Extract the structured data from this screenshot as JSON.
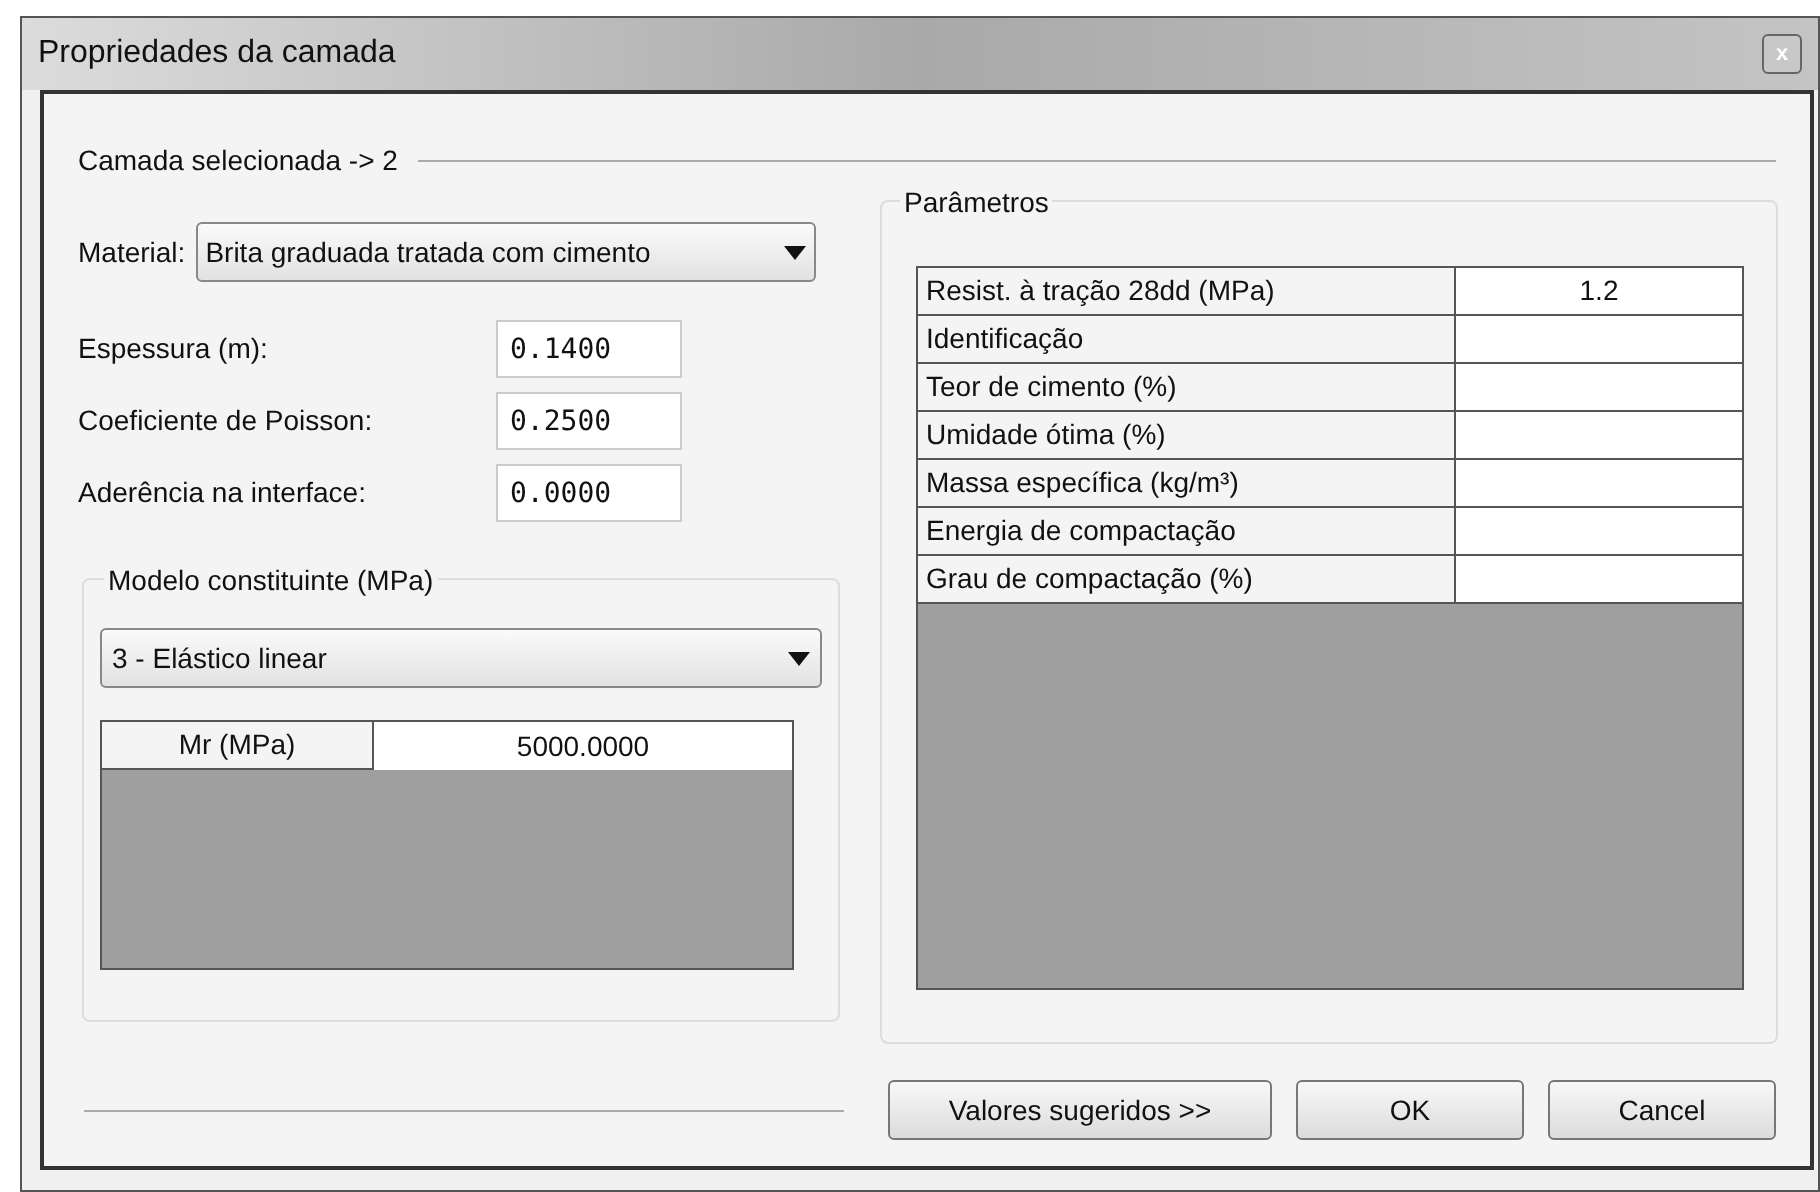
{
  "window": {
    "title": "Propriedades da camada",
    "close": "x"
  },
  "selected_layer": "Camada selecionada -> 2",
  "material": {
    "label": "Material:",
    "value": "Brita graduada tratada com cimento"
  },
  "fields": [
    {
      "label": "Espessura (m):",
      "value": "0.1400"
    },
    {
      "label": "Coeficiente de Poisson:",
      "value": "0.2500"
    },
    {
      "label": "Aderência na interface:",
      "value": "0.0000"
    }
  ],
  "model": {
    "title": "Modelo constituinte (MPa)",
    "value": "3 - Elástico linear",
    "rows": [
      {
        "name": "Mr (MPa)",
        "value": "5000.0000"
      }
    ]
  },
  "parameters": {
    "title": "Parâmetros",
    "rows": [
      {
        "name": "Resist. à tração 28dd (MPa)",
        "value": "1.2"
      },
      {
        "name": "Identificação"
      },
      {
        "name": "Teor de cimento (%)"
      },
      {
        "name": "Umidade ótima (%)"
      },
      {
        "name": "Massa específica (kg/m³)"
      },
      {
        "name": "Energia de compactação"
      },
      {
        "name": "Grau de compactação (%)"
      }
    ]
  },
  "buttons": [
    "Valores sugeridos >>",
    "OK",
    "Cancel"
  ]
}
